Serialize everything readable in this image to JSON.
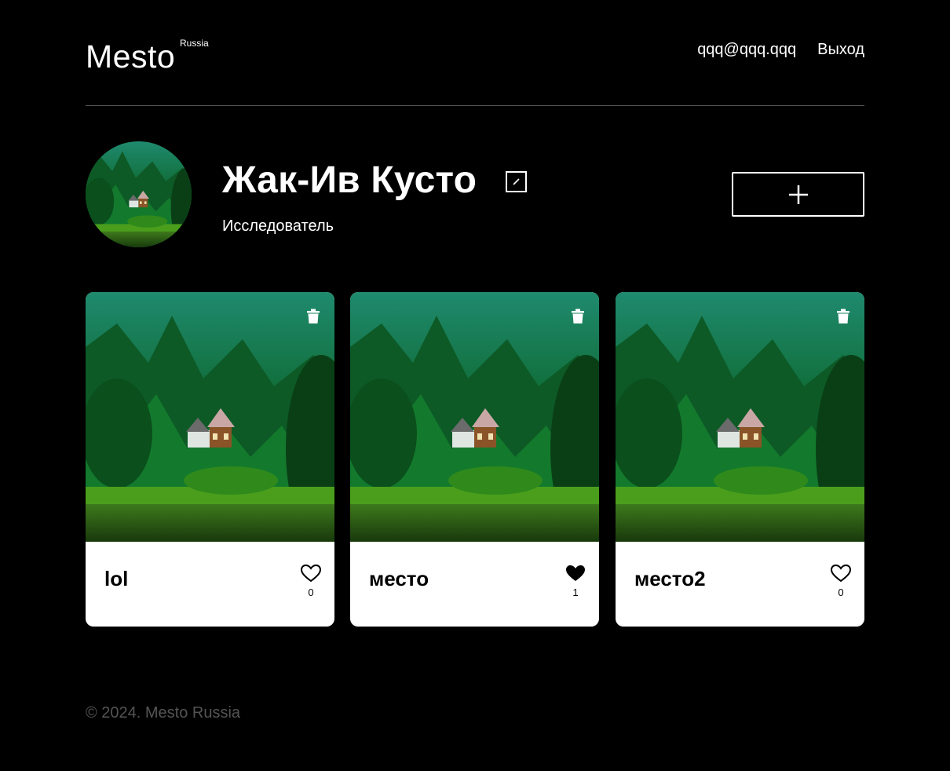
{
  "header": {
    "logo_main": "Mesto",
    "logo_sup": "Russia",
    "email": "qqq@qqq.qqq",
    "logout_label": "Выход"
  },
  "profile": {
    "name": "Жак-Ив Кусто",
    "about": "Исследователь",
    "edit_icon": "pencil-icon",
    "add_icon": "plus-icon"
  },
  "cards": [
    {
      "title": "lol",
      "likes": "0",
      "liked": false
    },
    {
      "title": "место",
      "likes": "1",
      "liked": true
    },
    {
      "title": "место2",
      "likes": "0",
      "liked": false
    }
  ],
  "footer": {
    "copyright": "© 2024. Mesto Russia"
  },
  "colors": {
    "background": "#000000",
    "card_bg": "#ffffff",
    "divider": "#545454",
    "footer_text": "#545454"
  }
}
